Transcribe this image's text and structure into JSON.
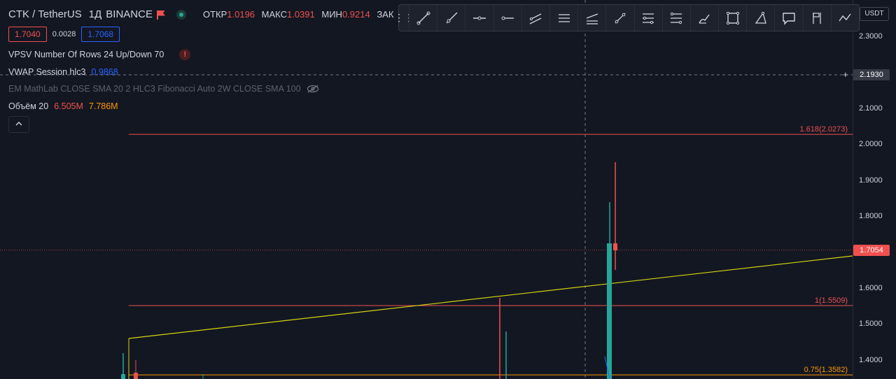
{
  "symbol": {
    "name": "CTK / TetherUS",
    "interval": "1Д",
    "exchange": "BINANCE"
  },
  "ohlc": {
    "open_label": "ОТКР",
    "open": "1.0196",
    "high_label": "МАКС",
    "high": "1.0391",
    "low_label": "МИН",
    "low": "0.9214",
    "close_label": "ЗАК"
  },
  "quote": {
    "sell": "1.7040",
    "spread": "0.0028",
    "buy": "1.7068"
  },
  "indicators": {
    "vpsv": "VPSV Number Of Rows 24 Up/Down 70",
    "vwap_label": "VWAP Session hlc3",
    "vwap_value": "0.9868",
    "em_label": "EM MathLab CLOSE SMA 20 2 HLC3 Fibonacci Auto 2W CLOSE SMA 100",
    "volume_label": "Объём 20",
    "volume_value1": "6.505M",
    "volume_value2": "7.786M"
  },
  "price_axis": {
    "currency": "USDT",
    "ticks": [
      "2.3000",
      "2.1000",
      "2.0000",
      "1.9000",
      "1.8000",
      "1.6000",
      "1.5000",
      "1.4000"
    ],
    "tick_values": [
      2.3,
      2.1,
      2.0,
      1.9,
      1.8,
      1.6,
      1.5,
      1.4
    ],
    "crosshair_price": "2.1930",
    "crosshair_value": 2.193,
    "current_price": "1.7054",
    "current_value": 1.7054
  },
  "fib_levels": [
    {
      "label": "1.618(2.0273)",
      "value": 2.0273,
      "color": "#f0504f"
    },
    {
      "label": "1(1.5509)",
      "value": 1.5509,
      "color": "#f0504f"
    },
    {
      "label": "0.75(1.3582)",
      "value": 1.3582,
      "color": "#ff9800"
    }
  ],
  "toolbar": {
    "tools": [
      "trend-line-icon",
      "ray-icon",
      "horizontal-ray-icon",
      "info-line-icon",
      "parallel-channel-icon",
      "horizontal-lines-icon",
      "regression-trend-icon",
      "pitchfork-icon",
      "fib-retracement-icon",
      "fib-extension-icon",
      "brush-icon",
      "rectangle-icon",
      "path-icon",
      "callout-icon",
      "long-position-icon",
      "forecast-icon"
    ]
  },
  "colors": {
    "background": "#131722",
    "up": "#26a69a",
    "down": "#f0504f",
    "sma_line": "#d4d40f",
    "accent_blue": "#2962ff"
  }
}
